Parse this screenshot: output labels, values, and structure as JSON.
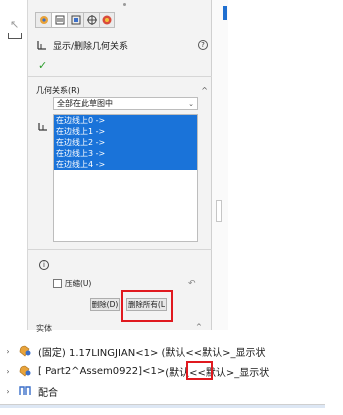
{
  "panel": {
    "title": "显示/删除几何关系",
    "help": "?",
    "ok": "✓",
    "section_label": "几何关系(R)",
    "filter_value": "全部在此草图中",
    "relations": [
      "在边线上0 ->",
      "在边线上1 ->",
      "在边线上2 ->",
      "在边线上3 ->",
      "在边线上4 ->"
    ],
    "info": "i",
    "compress_label": "压缩(U)",
    "delete_label": "删除(D)",
    "delete_all_label": "删除所有(L",
    "bottom_section": "实体"
  },
  "tabs": [
    "feature-manager-icon",
    "property-manager-icon",
    "configuration-manager-icon",
    "dim-xpert-icon",
    "display-manager-icon"
  ],
  "tree": {
    "rows": [
      {
        "icon": "fixed-part-icon",
        "text": "(固定) 1.17LINGJIAN<1> (默认<<默认>_显示状"
      },
      {
        "icon": "part-icon",
        "prefix": "[ Part2^Assem0922",
        "boxed": "]<1>",
        "suffix": " (默认<<默认>_显示状"
      },
      {
        "icon": "mates-icon",
        "text": "配合"
      }
    ]
  },
  "colors": {
    "selection": "#1a73d9",
    "highlight": "#e0191f"
  }
}
